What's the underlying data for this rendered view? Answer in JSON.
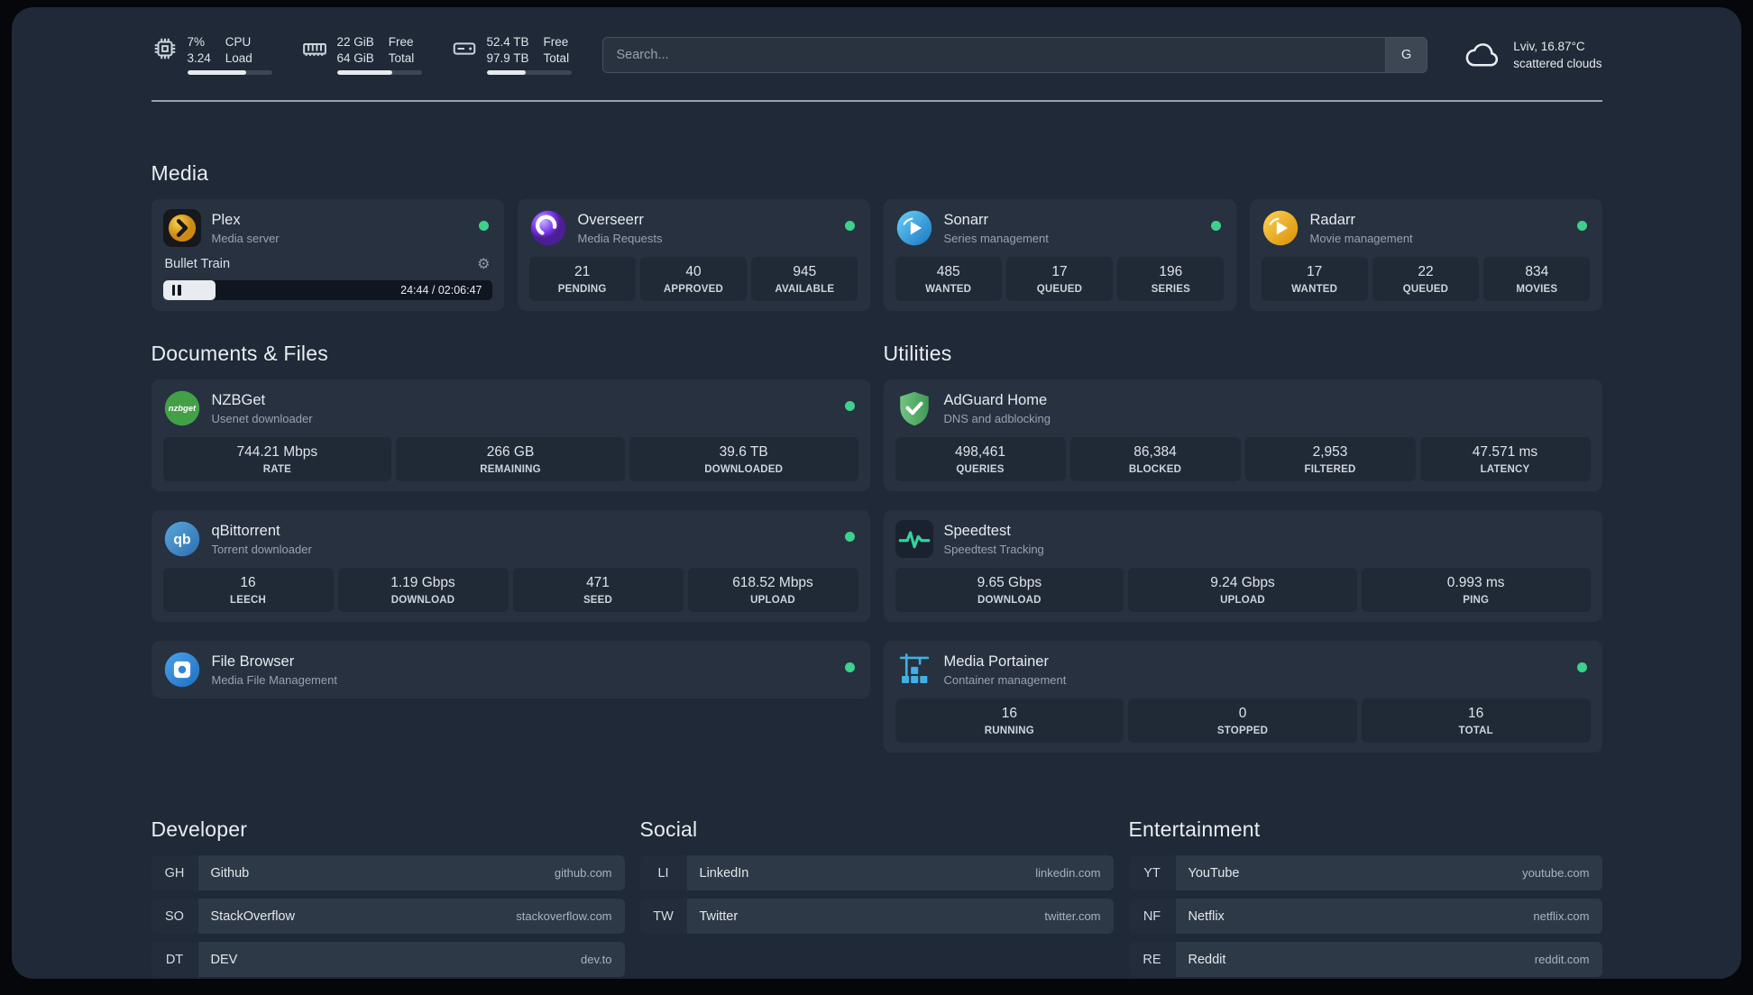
{
  "topbar": {
    "resources": [
      {
        "value1": "7%",
        "value2": "3.24",
        "label1": "CPU",
        "label2": "Load",
        "progress": 70
      },
      {
        "value1": "22 GiB",
        "value2": "64 GiB",
        "label1": "Free",
        "label2": "Total",
        "progress": 65
      },
      {
        "value1": "52.4 TB",
        "value2": "97.9 TB",
        "label1": "Free",
        "label2": "Total",
        "progress": 46
      }
    ],
    "search": {
      "placeholder": "Search...",
      "button": "G"
    },
    "weather": {
      "line1": "Lviv, 16.87°C",
      "line2": "scattered clouds"
    }
  },
  "media": {
    "heading": "Media",
    "plex": {
      "title": "Plex",
      "subtitle": "Media server",
      "now_playing": "Bullet Train",
      "time": "24:44 / 02:06:47",
      "progress": 16,
      "gear": "⚙"
    },
    "overseerr": {
      "title": "Overseerr",
      "subtitle": "Media Requests",
      "stats": [
        {
          "value": "21",
          "label": "PENDING"
        },
        {
          "value": "40",
          "label": "APPROVED"
        },
        {
          "value": "945",
          "label": "AVAILABLE"
        }
      ]
    },
    "sonarr": {
      "title": "Sonarr",
      "subtitle": "Series management",
      "stats": [
        {
          "value": "485",
          "label": "WANTED"
        },
        {
          "value": "17",
          "label": "QUEUED"
        },
        {
          "value": "196",
          "label": "SERIES"
        }
      ]
    },
    "radarr": {
      "title": "Radarr",
      "subtitle": "Movie management",
      "stats": [
        {
          "value": "17",
          "label": "WANTED"
        },
        {
          "value": "22",
          "label": "QUEUED"
        },
        {
          "value": "834",
          "label": "MOVIES"
        }
      ]
    }
  },
  "documents": {
    "heading": "Documents & Files",
    "nzbget": {
      "title": "NZBGet",
      "subtitle": "Usenet downloader",
      "icon_text": "nzbget",
      "stats": [
        {
          "value": "744.21 Mbps",
          "label": "RATE"
        },
        {
          "value": "266 GB",
          "label": "REMAINING"
        },
        {
          "value": "39.6 TB",
          "label": "DOWNLOADED"
        }
      ]
    },
    "qbittorrent": {
      "title": "qBittorrent",
      "subtitle": "Torrent downloader",
      "icon_text": "qb",
      "stats": [
        {
          "value": "16",
          "label": "LEECH"
        },
        {
          "value": "1.19 Gbps",
          "label": "DOWNLOAD"
        },
        {
          "value": "471",
          "label": "SEED"
        },
        {
          "value": "618.52 Mbps",
          "label": "UPLOAD"
        }
      ]
    },
    "filebrowser": {
      "title": "File Browser",
      "subtitle": "Media File Management"
    }
  },
  "utilities": {
    "heading": "Utilities",
    "adguard": {
      "title": "AdGuard Home",
      "subtitle": "DNS and adblocking",
      "stats": [
        {
          "value": "498,461",
          "label": "QUERIES"
        },
        {
          "value": "86,384",
          "label": "BLOCKED"
        },
        {
          "value": "2,953",
          "label": "FILTERED"
        },
        {
          "value": "47.571 ms",
          "label": "LATENCY"
        }
      ]
    },
    "speedtest": {
      "title": "Speedtest",
      "subtitle": "Speedtest Tracking",
      "stats": [
        {
          "value": "9.65 Gbps",
          "label": "DOWNLOAD"
        },
        {
          "value": "9.24 Gbps",
          "label": "UPLOAD"
        },
        {
          "value": "0.993 ms",
          "label": "PING"
        }
      ]
    },
    "portainer": {
      "title": "Media Portainer",
      "subtitle": "Container management",
      "stats": [
        {
          "value": "16",
          "label": "RUNNING"
        },
        {
          "value": "0",
          "label": "STOPPED"
        },
        {
          "value": "16",
          "label": "TOTAL"
        }
      ]
    }
  },
  "bookmarks": {
    "developer": {
      "heading": "Developer",
      "items": [
        {
          "abbr": "GH",
          "name": "Github",
          "domain": "github.com"
        },
        {
          "abbr": "SO",
          "name": "StackOverflow",
          "domain": "stackoverflow.com"
        },
        {
          "abbr": "DT",
          "name": "DEV",
          "domain": "dev.to"
        }
      ]
    },
    "social": {
      "heading": "Social",
      "items": [
        {
          "abbr": "LI",
          "name": "LinkedIn",
          "domain": "linkedin.com"
        },
        {
          "abbr": "TW",
          "name": "Twitter",
          "domain": "twitter.com"
        }
      ]
    },
    "entertainment": {
      "heading": "Entertainment",
      "items": [
        {
          "abbr": "YT",
          "name": "YouTube",
          "domain": "youtube.com"
        },
        {
          "abbr": "NF",
          "name": "Netflix",
          "domain": "netflix.com"
        },
        {
          "abbr": "RE",
          "name": "Reddit",
          "domain": "reddit.com"
        }
      ]
    }
  }
}
